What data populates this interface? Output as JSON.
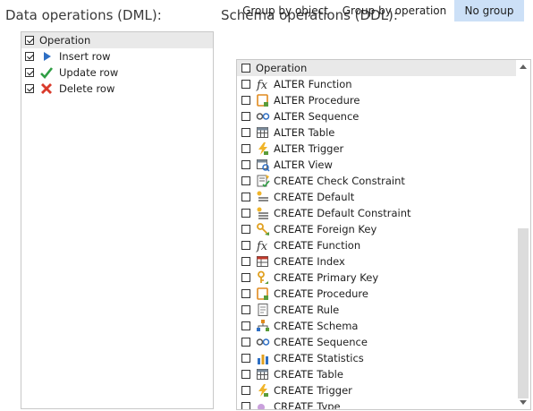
{
  "dml": {
    "title": "Data operations (DML):",
    "header": "Operation",
    "items": [
      {
        "label": "Insert row",
        "icon": "play-triangle-icon",
        "checked": true
      },
      {
        "label": "Update row",
        "icon": "green-check-icon",
        "checked": true
      },
      {
        "label": "Delete row",
        "icon": "red-x-icon",
        "checked": true
      }
    ]
  },
  "ddl": {
    "title": "Schema operations (DDL):",
    "tabs": {
      "by_object": "Group by object",
      "by_operation": "Group by operation",
      "no_group": "No group"
    },
    "active_tab": "no_group",
    "header": "Operation",
    "items": [
      {
        "label": "ALTER Function",
        "icon": "function-icon"
      },
      {
        "label": "ALTER Procedure",
        "icon": "procedure-icon"
      },
      {
        "label": "ALTER Sequence",
        "icon": "sequence-icon"
      },
      {
        "label": "ALTER Table",
        "icon": "table-icon"
      },
      {
        "label": "ALTER Trigger",
        "icon": "trigger-icon"
      },
      {
        "label": "ALTER View",
        "icon": "view-icon"
      },
      {
        "label": "CREATE Check Constraint",
        "icon": "check-constraint-icon"
      },
      {
        "label": "CREATE Default",
        "icon": "default-icon"
      },
      {
        "label": "CREATE Default Constraint",
        "icon": "default-constraint-icon"
      },
      {
        "label": "CREATE Foreign Key",
        "icon": "foreign-key-icon"
      },
      {
        "label": "CREATE Function",
        "icon": "function-icon"
      },
      {
        "label": "CREATE Index",
        "icon": "index-icon"
      },
      {
        "label": "CREATE Primary Key",
        "icon": "primary-key-icon"
      },
      {
        "label": "CREATE Procedure",
        "icon": "procedure-icon"
      },
      {
        "label": "CREATE Rule",
        "icon": "rule-icon"
      },
      {
        "label": "CREATE Schema",
        "icon": "schema-icon"
      },
      {
        "label": "CREATE Sequence",
        "icon": "sequence-icon"
      },
      {
        "label": "CREATE Statistics",
        "icon": "statistics-icon"
      },
      {
        "label": "CREATE Table",
        "icon": "table-icon"
      },
      {
        "label": "CREATE Trigger",
        "icon": "trigger-icon"
      },
      {
        "label": "CREATE Type",
        "icon": "type-icon"
      }
    ]
  },
  "colors": {
    "active_tab": "#cce0f7",
    "header_row": "#e9e9e9",
    "border": "#c8c8c8"
  }
}
